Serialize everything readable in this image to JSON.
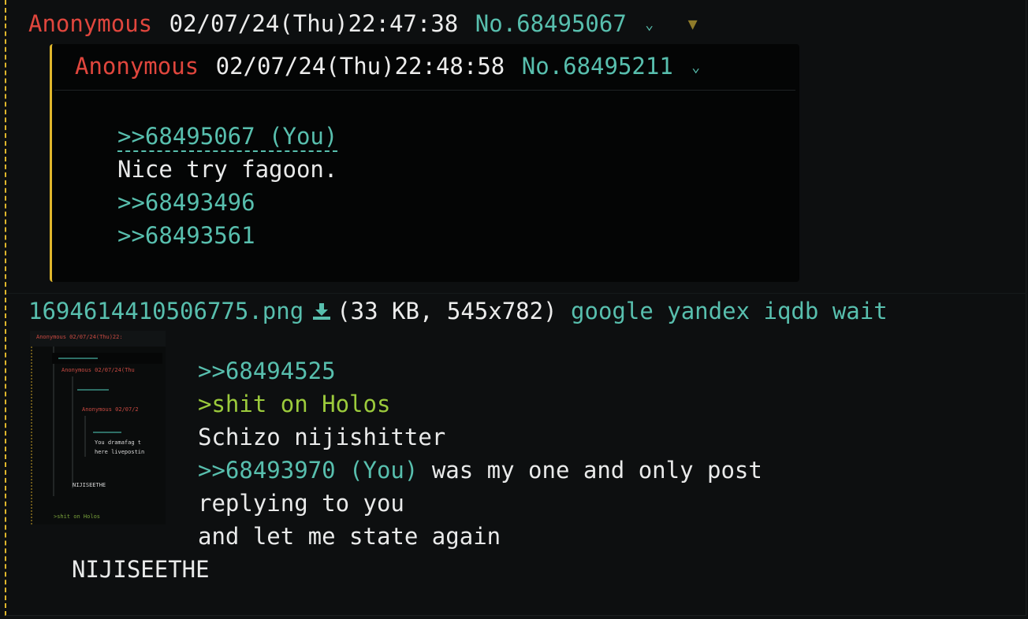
{
  "post": {
    "name": "Anonymous",
    "date": "02/07/24(Thu)22:47:38",
    "number": "No.68495067",
    "menu_icon": "chevron-down-icon",
    "hide_icon": "triangle-down-icon"
  },
  "quoted_post": {
    "name": "Anonymous",
    "date": "02/07/24(Thu)22:48:58",
    "number": "No.68495211",
    "lines": {
      "reply_link": ">>68495067 (You)",
      "text": "Nice try fagoon.",
      "link1": ">>68493496",
      "link2": ">>68493561"
    }
  },
  "file": {
    "filename": "1694614410506775.png",
    "download_icon": "download-icon",
    "info": "(33 KB, 545x782)",
    "search_links": [
      "google",
      "yandex",
      "iqdb",
      "wait"
    ]
  },
  "thumbnail": {
    "text": {
      "hdr1": "Anonymous 02/07/24(Thu)22:",
      "hdr2": "Anonymous 02/07/24(Thu",
      "hdr3": "Anonymous 02/07/2",
      "line1": "You dramafag t",
      "line2": "here livepostin",
      "line3": "NIJISEETHE",
      "line4": ">shit on Holos"
    }
  },
  "body": {
    "link1": ">>68494525",
    "greentext": ">shit on Holos",
    "line3": "Schizo nijishitter",
    "link2": ">>68493970 (You)",
    "line4_rest": " was my one and only post",
    "line5": "replying to you",
    "line6": "and let me state again",
    "signature": "NIJISEETHE"
  },
  "colors": {
    "name": "#e0463d",
    "link": "#58bfae",
    "greentext": "#9ccb3c",
    "accent_border": "#e0b72c",
    "background": "#0d0f10"
  }
}
